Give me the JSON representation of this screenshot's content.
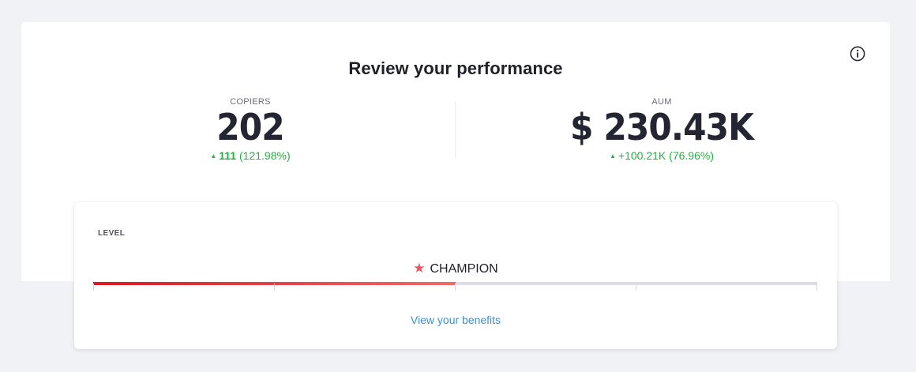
{
  "header": {
    "title": "Review your performance"
  },
  "stats": {
    "copiers": {
      "label": "COPIERS",
      "value": "202",
      "change_abs": "111",
      "change_pct": "(121.98%)"
    },
    "aum": {
      "label": "AUM",
      "value": "$ 230.43K",
      "change_abs": "+100.21K",
      "change_pct": "(76.96%)"
    }
  },
  "level": {
    "label": "LEVEL",
    "name": "CHAMPION",
    "progress_fraction": 0.5,
    "segments": 4,
    "benefits_link": "View your benefits"
  },
  "colors": {
    "positive": "#1fb53e",
    "progress_start": "#d9191f",
    "progress_end": "#f06a6a",
    "link": "#3d8fd8",
    "star": "#ef5461"
  },
  "icons": {
    "info": "info-circle-icon",
    "level": "star-icon",
    "up": "triangle-up-icon"
  }
}
